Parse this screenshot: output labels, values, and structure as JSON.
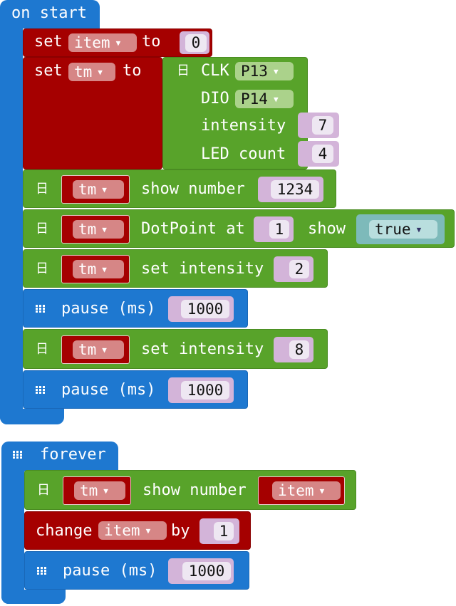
{
  "on_start": {
    "hat": "on start",
    "set_item": {
      "label": "set",
      "var": "item",
      "to": "to",
      "value": "0"
    },
    "set_tm": {
      "label": "set",
      "var": "tm",
      "to": "to",
      "clk_label": "CLK",
      "clk_value": "P13",
      "dio_label": "DIO",
      "dio_value": "P14",
      "intensity_label": "intensity",
      "intensity_value": "7",
      "ledcount_label": "LED count",
      "ledcount_value": "4"
    },
    "show_number": {
      "var": "tm",
      "label": "show number",
      "value": "1234"
    },
    "dotpoint": {
      "var": "tm",
      "label": "DotPoint at",
      "value": "1",
      "show_label": "show",
      "show_value": "true"
    },
    "set_intensity_1": {
      "var": "tm",
      "label": "set intensity",
      "value": "2"
    },
    "pause_1": {
      "label": "pause (ms)",
      "value": "1000"
    },
    "set_intensity_2": {
      "var": "tm",
      "label": "set intensity",
      "value": "8"
    },
    "pause_2": {
      "label": "pause (ms)",
      "value": "1000"
    }
  },
  "forever": {
    "hat": "forever",
    "show_number": {
      "var": "tm",
      "label": "show number",
      "value_var": "item"
    },
    "change": {
      "label": "change",
      "var": "item",
      "by": "by",
      "value": "1"
    },
    "pause": {
      "label": "pause (ms)",
      "value": "1000"
    }
  },
  "icons": {
    "tm_icon": "日",
    "grid_icon": "led-grid-icon",
    "caret": "▾"
  },
  "colors": {
    "event_blue": "#1e78d0",
    "variable_red": "#a50000",
    "tm1637_green": "#58a32a",
    "number_slot": "#d3b4d9"
  }
}
